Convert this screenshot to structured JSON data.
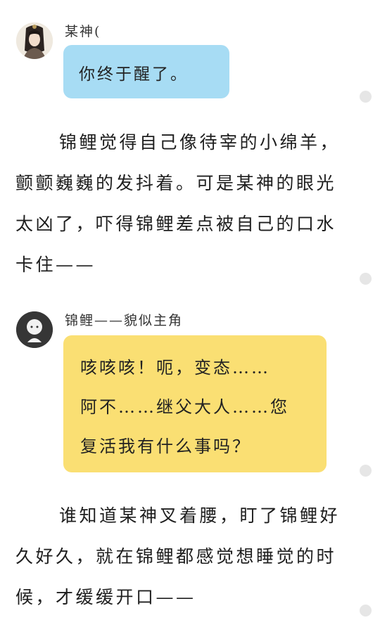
{
  "chat1": {
    "name": "某神(",
    "bubble": "你终于醒了。",
    "bubble_color": "#a7dcf4"
  },
  "paragraph1": "锦鲤觉得自己像待宰的小绵羊，颤颤巍巍的发抖着。可是某神的眼光太凶了，吓得锦鲤差点被自己的口水卡住——",
  "chat2": {
    "name": "锦鲤——貌似主角",
    "lines": [
      "咳咳咳！呃，变态……",
      "阿不……继父大人……您",
      "复活我有什么事吗？"
    ],
    "bubble_color": "#fadf73"
  },
  "paragraph2": "谁知道某神叉着腰，盯了锦鲤好久好久，就在锦鲤都感觉想睡觉的时候，才缓缓开口——"
}
